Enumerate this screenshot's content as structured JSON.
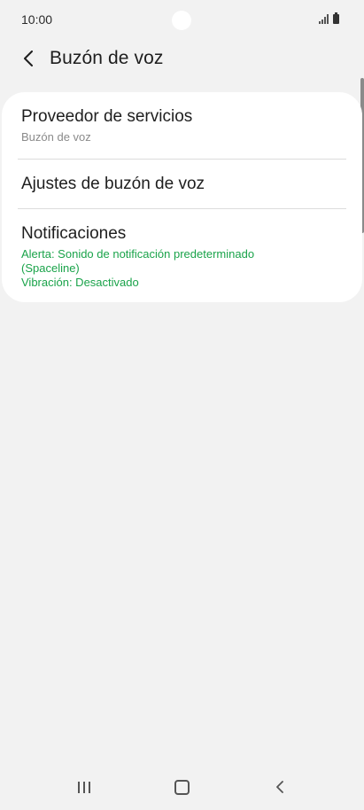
{
  "status_bar": {
    "time": "10:00"
  },
  "header": {
    "title": "Buzón de voz",
    "back_icon": "chevron-left-icon"
  },
  "items": [
    {
      "title": "Proveedor de servicios",
      "subtitle": "Buzón de voz"
    },
    {
      "title": "Ajustes de buzón de voz"
    },
    {
      "title": "Notificaciones",
      "alert_line_1": "Alerta: Sonido de notificación predeterminado",
      "alert_line_2": "(Spaceline)",
      "vibration": "Vibración: Desactivado"
    }
  ],
  "colors": {
    "background": "#f2f2f2",
    "card": "#ffffff",
    "accent_green": "#1aa34a",
    "subtitle_gray": "#8a8a8a"
  },
  "nav_bar": {
    "recents_icon": "recents-icon",
    "home_icon": "home-icon",
    "back_icon": "back-nav-icon"
  }
}
